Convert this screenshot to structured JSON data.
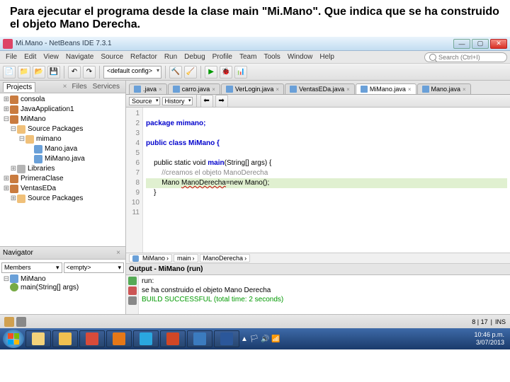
{
  "caption": "Para ejecutar el programa desde la clase main \"Mi.Mano\". Que indica que se ha construido el objeto Mano Derecha.",
  "title": "Mi.Mano - NetBeans IDE 7.3.1",
  "menu": [
    "File",
    "Edit",
    "View",
    "Navigate",
    "Source",
    "Refactor",
    "Run",
    "Debug",
    "Profile",
    "Team",
    "Tools",
    "Window",
    "Help"
  ],
  "search_placeholder": "Search (Ctrl+I)",
  "config_combo": "<default config>",
  "projects": {
    "tabs": [
      "Projects",
      "Files",
      "Services"
    ],
    "items": [
      {
        "lvl": 0,
        "tw": "⊞",
        "ic": "ic-prj",
        "label": "consola"
      },
      {
        "lvl": 0,
        "tw": "⊞",
        "ic": "ic-prj",
        "label": "JavaApplication1"
      },
      {
        "lvl": 0,
        "tw": "⊟",
        "ic": "ic-prj",
        "label": "MiMano"
      },
      {
        "lvl": 1,
        "tw": "⊟",
        "ic": "ic-fold",
        "label": "Source Packages"
      },
      {
        "lvl": 2,
        "tw": "⊟",
        "ic": "ic-fold",
        "label": "mimano"
      },
      {
        "lvl": 3,
        "tw": "",
        "ic": "ic-java",
        "label": "Mano.java"
      },
      {
        "lvl": 3,
        "tw": "",
        "ic": "ic-java",
        "label": "MiMano.java"
      },
      {
        "lvl": 1,
        "tw": "⊞",
        "ic": "ic-lib",
        "label": "Libraries"
      },
      {
        "lvl": 0,
        "tw": "⊞",
        "ic": "ic-prj",
        "label": "PrimeraClase"
      },
      {
        "lvl": 0,
        "tw": "⊞",
        "ic": "ic-prj",
        "label": "VentasEDa"
      },
      {
        "lvl": 1,
        "tw": "⊞",
        "ic": "ic-fold",
        "label": "Source Packages"
      }
    ]
  },
  "navigator": {
    "title": "Navigator",
    "combo1": "Members",
    "combo2": "<empty>",
    "class": "MiMano",
    "method": "main(String[] args)"
  },
  "editor": {
    "tabs": [
      {
        "label": ".java",
        "active": false
      },
      {
        "label": "carro.java",
        "active": false
      },
      {
        "label": "VerLogin.java",
        "active": false
      },
      {
        "label": "VentasEDa.java",
        "active": false
      },
      {
        "label": "MiMano.java",
        "active": true
      },
      {
        "label": "Mano.java",
        "active": false
      }
    ],
    "subtabs": [
      "Source",
      "History"
    ],
    "lines": [
      "1",
      "2",
      "3",
      "4",
      "5",
      "6",
      "7",
      "8",
      "9",
      "10",
      "11"
    ],
    "code": {
      "l2": "package mimano;",
      "l4": "public class MiMano {",
      "l6a": "    public static void ",
      "l6b": "main",
      "l6c": "(String[] args) {",
      "l7": "        //creamos el objeto ManoDerecha",
      "l8a": "        Mano ",
      "l8b": "ManoDerecha",
      "l8c": "=new Mano();",
      "l9": "    }"
    },
    "breadcrumb": [
      "MiMano",
      "main",
      "ManoDerecha"
    ]
  },
  "output": {
    "title": "Output - MiMano (run)",
    "lines": [
      {
        "text": "run:",
        "cls": ""
      },
      {
        "text": "se ha construido el objeto Mano Derecha",
        "cls": ""
      },
      {
        "text": "BUILD SUCCESSFUL (total time: 2 seconds)",
        "cls": "ok"
      }
    ]
  },
  "status": {
    "pos": "8 | 17",
    "ins": "INS"
  },
  "clock": {
    "time": "10:46 p.m.",
    "date": "3/07/2013"
  },
  "task_apps": [
    {
      "name": "explorer",
      "color": "#f3d27a"
    },
    {
      "name": "folder",
      "color": "#f0c050"
    },
    {
      "name": "chrome",
      "color": "#d84b3a"
    },
    {
      "name": "firefox",
      "color": "#e67817"
    },
    {
      "name": "skype",
      "color": "#2aa7df"
    },
    {
      "name": "powerpoint",
      "color": "#d24726"
    },
    {
      "name": "netbeans",
      "color": "#3b7bbf"
    },
    {
      "name": "word",
      "color": "#2b579a"
    }
  ]
}
